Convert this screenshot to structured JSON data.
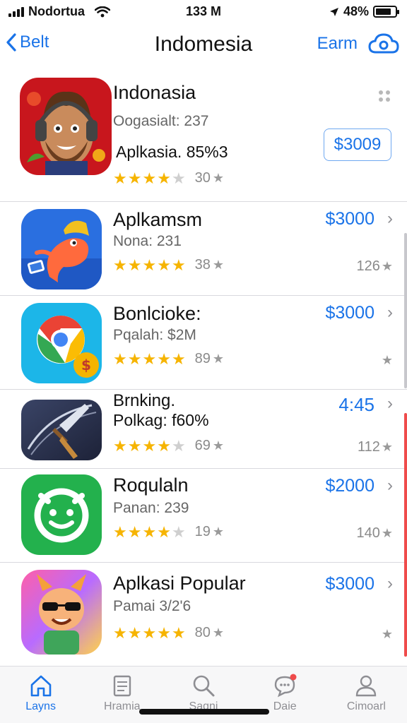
{
  "status_bar": {
    "carrier": "Nodortua",
    "time": "133 M",
    "battery": "48%",
    "battery_level": 0.8
  },
  "nav": {
    "back_label": "Belt",
    "title": "Indomesia",
    "right_label": "Earm",
    "right_icon": "cloud-icon"
  },
  "apps": [
    {
      "name": "Indonasia",
      "sub": "Oogasialt: 237",
      "sub2": "Aplkasia. 85%3",
      "rating": 3.5,
      "count": "30",
      "price": "$3009",
      "icon": "bearded-man-headphones-icon",
      "colors": [
        "#c8161d",
        "#f4b183"
      ]
    },
    {
      "name": "Aplkamsm",
      "sub": "Nona: 231",
      "rating": 5,
      "count": "38",
      "price": "$3000",
      "right_count": "126",
      "icon": "cartoon-fish-icon",
      "colors": [
        "#2a6fe0",
        "#ff6a3d"
      ]
    },
    {
      "name": "Bonlcioke:",
      "sub": "Pqalah: $2M",
      "rating": 5,
      "count": "89",
      "price": "$3000",
      "right_count": "",
      "icon": "chrome-coin-icon",
      "colors": [
        "#1cb6e8",
        "#ea4335"
      ]
    },
    {
      "name": "Brnking.",
      "sub2": "Polkag: f60%",
      "rating": 4,
      "count": "69",
      "price": "4:45",
      "right_count": "112",
      "icon": "knife-sword-icon",
      "colors": [
        "#2a3350",
        "#c68a3c"
      ]
    },
    {
      "name": "Roqulaln",
      "sub": "Panan: 239",
      "rating": 3.5,
      "count": "19",
      "price": "$2000",
      "right_count": "140",
      "icon": "green-smile-icon",
      "colors": [
        "#23b14d",
        "#ffffff"
      ]
    },
    {
      "name": "Aplkasi Popular",
      "sub": "Pamai 3/2'6",
      "rating": 4.5,
      "count": "80",
      "price": "$3000",
      "right_count": "",
      "icon": "cat-sunglasses-icon",
      "colors": [
        "#ff5fa8",
        "#ffd24a"
      ]
    }
  ],
  "tabs": [
    {
      "label": "Layns",
      "icon": "home-icon",
      "active": true
    },
    {
      "label": "Hramia",
      "icon": "document-icon",
      "active": false
    },
    {
      "label": "Sagni",
      "icon": "search-icon",
      "active": false
    },
    {
      "label": "Daie",
      "icon": "chat-icon",
      "active": false
    },
    {
      "label": "Cimoarl",
      "icon": "person-icon",
      "active": false
    }
  ],
  "colors": {
    "accent": "#1a73e8",
    "star": "#f6b400",
    "scroll_red": "#ef4b4b"
  }
}
